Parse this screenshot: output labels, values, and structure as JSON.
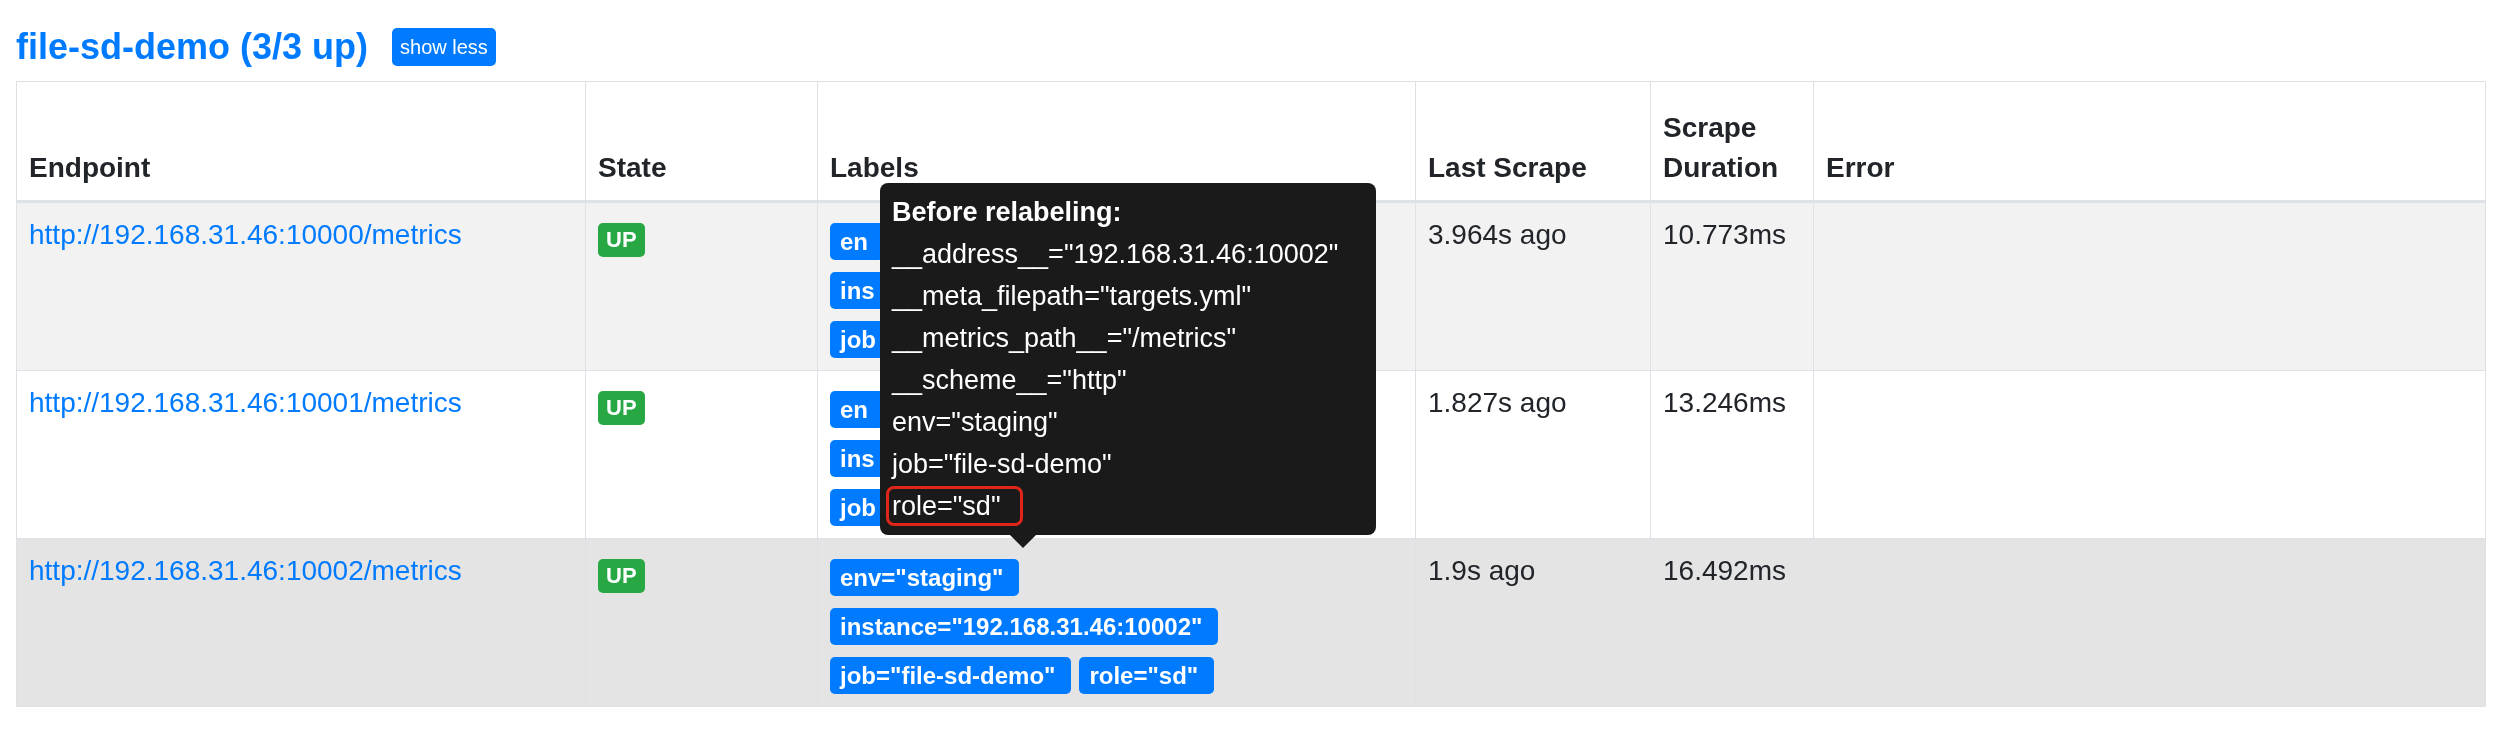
{
  "title": "file-sd-demo (3/3 up)",
  "toggle_button": "show less",
  "table": {
    "columns": [
      "Endpoint",
      "State",
      "Labels",
      "Last Scrape",
      "Scrape Duration",
      "Error"
    ],
    "rows": [
      {
        "endpoint": "http://192.168.31.46:10000/metrics",
        "state": "UP",
        "label_lines": [
          [
            "en"
          ],
          [
            "ins"
          ],
          [
            "job"
          ]
        ],
        "last_scrape": "3.964s ago",
        "scrape_duration": "10.773ms",
        "hovered": false
      },
      {
        "endpoint": "http://192.168.31.46:10001/metrics",
        "state": "UP",
        "label_lines": [
          [
            "en"
          ],
          [
            "ins"
          ],
          [
            "job"
          ]
        ],
        "last_scrape": "1.827s ago",
        "scrape_duration": "13.246ms",
        "hovered": false
      },
      {
        "endpoint": "http://192.168.31.46:10002/metrics",
        "state": "UP",
        "label_lines": [
          [
            "env=\"staging\""
          ],
          [
            "instance=\"192.168.31.46:10002\""
          ],
          [
            "job=\"file-sd-demo\"",
            "role=\"sd\""
          ]
        ],
        "last_scrape": "1.9s ago",
        "scrape_duration": "16.492ms",
        "hovered": true,
        "tooltip": {
          "title": "Before relabeling:",
          "lines": [
            {
              "text": "__address__=\"192.168.31.46:10002\"",
              "highlighted": false
            },
            {
              "text": "__meta_filepath=\"targets.yml\"",
              "highlighted": false
            },
            {
              "text": "__metrics_path__=\"/metrics\"",
              "highlighted": false
            },
            {
              "text": "__scheme__=\"http\"",
              "highlighted": false
            },
            {
              "text": "env=\"staging\"",
              "highlighted": false
            },
            {
              "text": "job=\"file-sd-demo\"",
              "highlighted": false
            },
            {
              "text": "role=\"sd\"",
              "highlighted": true
            }
          ]
        }
      }
    ]
  }
}
